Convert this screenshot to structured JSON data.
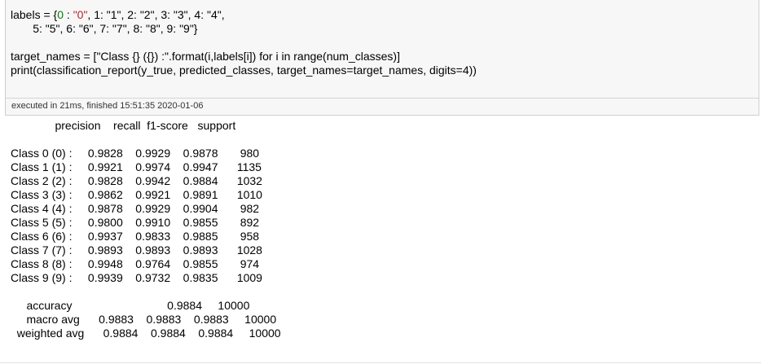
{
  "code": {
    "line1_a": "labels = {",
    "line1_b": "0",
    "line1_c": " : ",
    "line1_d": "\"0\"",
    "line1_rest": ", 1: \"1\", 2: \"2\", 3: \"3\", 4: \"4\",",
    "line2": "       5: \"5\", 6: \"6\", 7: \"7\", 8: \"8\", 9: \"9\"}",
    "line4": "target_names = [\"Class {} ({}) :\".format(i,labels[i]) for i in range(num_classes)]",
    "line5": "print(classification_report(y_true, predicted_classes, target_names=target_names, digits=4))"
  },
  "exec_status": "executed in 21ms, finished 15:51:35 2020-01-06",
  "report": {
    "header": "              precision    recall  f1-score   support",
    "rows": [
      "Class 0 (0) :     0.9828    0.9929    0.9878       980",
      "Class 1 (1) :     0.9921    0.9974    0.9947      1135",
      "Class 2 (2) :     0.9828    0.9942    0.9884      1032",
      "Class 3 (3) :     0.9862    0.9921    0.9891      1010",
      "Class 4 (4) :     0.9878    0.9929    0.9904       982",
      "Class 5 (5) :     0.9800    0.9910    0.9855       892",
      "Class 6 (6) :     0.9937    0.9833    0.9885       958",
      "Class 7 (7) :     0.9893    0.9893    0.9893      1028",
      "Class 8 (8) :     0.9948    0.9764    0.9855       974",
      "Class 9 (9) :     0.9939    0.9732    0.9835      1009"
    ],
    "accuracy": "     accuracy                              0.9884     10000",
    "macro": "     macro avg      0.9883    0.9883    0.9883     10000",
    "weighted": "  weighted avg      0.9884    0.9884    0.9884     10000"
  }
}
